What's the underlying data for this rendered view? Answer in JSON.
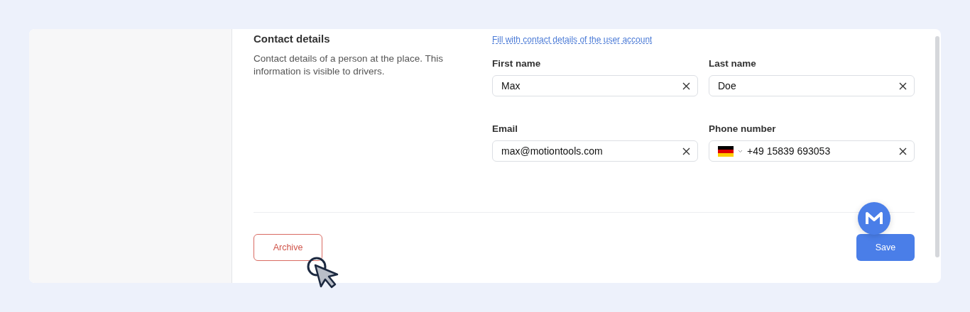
{
  "section": {
    "title": "Contact details",
    "description": "Contact details of a person at the place. This information is visible to drivers."
  },
  "fill_link": "Fill with contact details of the user account",
  "fields": [
    {
      "label": "First name",
      "value": "Max",
      "kind": "text"
    },
    {
      "label": "Last name",
      "value": "Doe",
      "kind": "text"
    },
    {
      "label": "Email",
      "value": "max@motiontools.com",
      "kind": "text"
    },
    {
      "label": "Phone number",
      "value": "+49 15839 693053",
      "kind": "phone"
    }
  ],
  "buttons": [
    {
      "label": "Archive",
      "kind": "danger"
    },
    {
      "label": "Save",
      "kind": "primary"
    }
  ]
}
